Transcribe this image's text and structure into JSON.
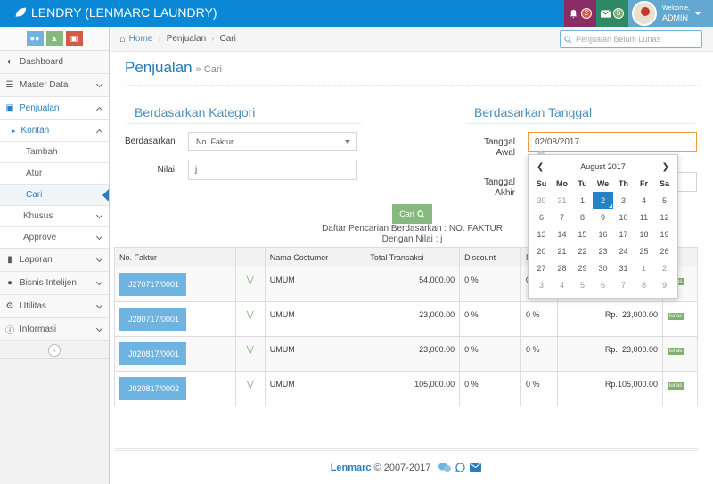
{
  "brand": "LENDRY (LENMARC LAUNDRY)",
  "notifications": {
    "bell_count": "2",
    "mail_count": "5"
  },
  "user": {
    "welcome": "Welcome,",
    "name": "ADMIN"
  },
  "search": {
    "placeholder": "Penjualan Belum Lunas"
  },
  "breadcrumbs": [
    "Home",
    "Penjualan",
    "Cari"
  ],
  "sidebar": {
    "items": [
      {
        "label": "Dashboard"
      },
      {
        "label": "Master Data"
      },
      {
        "label": "Penjualan"
      },
      {
        "label": "Kontan"
      },
      {
        "label": "Tambah"
      },
      {
        "label": "Atur"
      },
      {
        "label": "Cari"
      },
      {
        "label": "Khusus"
      },
      {
        "label": "Approve"
      },
      {
        "label": "Laporan"
      },
      {
        "label": "Bisnis Intelijen"
      },
      {
        "label": "Utilitas"
      },
      {
        "label": "Informasi"
      }
    ]
  },
  "page": {
    "title": "Penjualan",
    "subtitle": "» Cari"
  },
  "kategori": {
    "title": "Berdasarkan Kategori",
    "berdasarkan_label": "Berdasarkan",
    "berdasarkan_value": "No. Faktur",
    "nilai_label": "Nilai",
    "nilai_value": "j"
  },
  "tanggal": {
    "title": "Berdasarkan Tanggal",
    "awal_label_1": "Tanggal",
    "awal_label_2": "Awal",
    "awal_value": "02/08/2017",
    "akhir_label_1": "Tanggal",
    "akhir_label_2": "Akhir"
  },
  "button_cari": "Cari",
  "result": {
    "line1": "Daftar Pencarian Berdasarkan : NO. FAKTUR",
    "line2": "Dengan Nilai : j"
  },
  "table": {
    "headers": [
      "No. Faktur",
      "",
      "Nama Costumer",
      "Total Transaksi",
      "Discount",
      "P",
      "",
      "tus"
    ],
    "rows": [
      {
        "faktur": "J270717/0001",
        "customer": "UMUM",
        "total": "54,000.00",
        "discount": "0 %",
        "pct": "0",
        "rp": "",
        "amount": "",
        "status": "lunas"
      },
      {
        "faktur": "J280717/0001",
        "customer": "UMUM",
        "total": "23,000.00",
        "discount": "0 %",
        "pct": "0 %",
        "rp": "Rp.",
        "amount": "23,000.00",
        "status": "lunas"
      },
      {
        "faktur": "J020817/0001",
        "customer": "UMUM",
        "total": "23,000.00",
        "discount": "0 %",
        "pct": "0 %",
        "rp": "Rp.",
        "amount": "23,000.00",
        "status": "lunas"
      },
      {
        "faktur": "J020817/0002",
        "customer": "UMUM",
        "total": "105,000.00",
        "discount": "0 %",
        "pct": "0 %",
        "rp": "Rp.",
        "amount": "105,000.00",
        "status": "lunas"
      }
    ]
  },
  "datepicker": {
    "month": "August 2017",
    "dow": [
      "Su",
      "Mo",
      "Tu",
      "We",
      "Th",
      "Fr",
      "Sa"
    ],
    "weeks": [
      [
        "30",
        "31",
        "1",
        "2",
        "3",
        "4",
        "5"
      ],
      [
        "6",
        "7",
        "8",
        "9",
        "10",
        "11",
        "12"
      ],
      [
        "13",
        "14",
        "15",
        "16",
        "17",
        "18",
        "19"
      ],
      [
        "20",
        "21",
        "22",
        "23",
        "24",
        "25",
        "26"
      ],
      [
        "27",
        "28",
        "29",
        "30",
        "31",
        "1",
        "2"
      ],
      [
        "3",
        "4",
        "5",
        "6",
        "7",
        "8",
        "9"
      ]
    ],
    "selected": "2"
  },
  "footer": {
    "brand": "Lenmarc",
    "copyright": "© 2007-2017"
  },
  "colors": {
    "navbar": "#0a88d6",
    "accent": "#2b7dbc",
    "success": "#87b87f",
    "danger": "#d15b47"
  }
}
